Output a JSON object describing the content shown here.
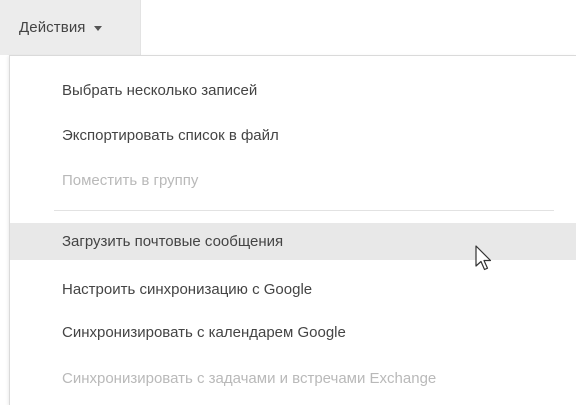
{
  "actions_button": {
    "label": "Действия"
  },
  "menu": {
    "items": [
      {
        "label": "Выбрать несколько записей",
        "enabled": true
      },
      {
        "label": "Экспортировать список в файл",
        "enabled": true
      },
      {
        "label": "Поместить в группу",
        "enabled": false
      },
      {
        "label": "Загрузить почтовые сообщения",
        "enabled": true,
        "hovered": true
      },
      {
        "label": "Настроить синхронизацию с Google",
        "enabled": true
      },
      {
        "label": "Синхронизировать с календарем Google",
        "enabled": true
      },
      {
        "label": "Синхронизировать с задачами и встречами Exchange",
        "enabled": false
      }
    ]
  },
  "colors": {
    "button_bg": "#ececec",
    "hover_bg": "#e8e8e8",
    "text": "#444444",
    "disabled_text": "#b9b9b9",
    "separator": "#e2e2e2"
  },
  "icons": {
    "caret": "caret-down-icon",
    "cursor": "mouse-pointer-icon"
  }
}
